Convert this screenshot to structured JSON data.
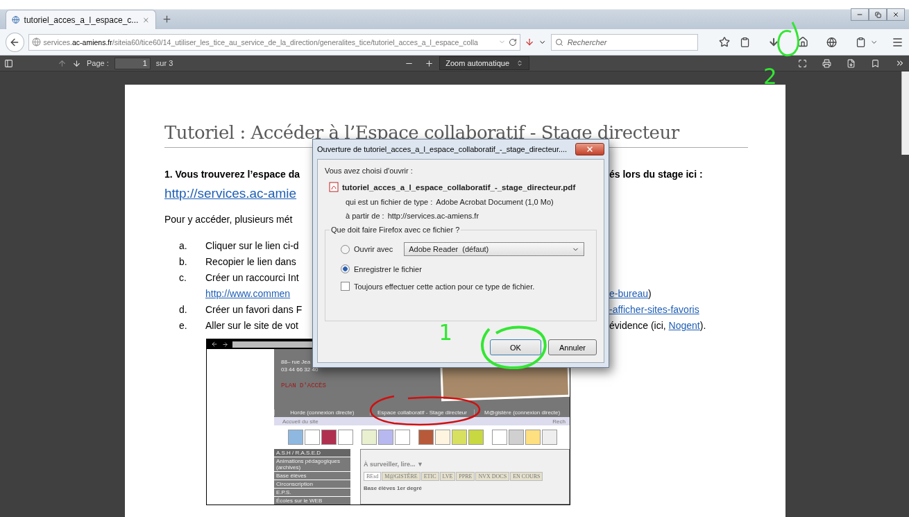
{
  "browser": {
    "tab": {
      "title": "tutoriel_acces_a_l_espace_c...",
      "selected": true
    },
    "address": {
      "prefix": "services.",
      "domain": "ac-amiens.fr",
      "path": "/siteia60/tice60/14_utiliser_les_tice_au_service_de_la_direction/generalites_tice/tutoriel_acces_a_l_espace_colla"
    },
    "search": {
      "placeholder": "Rechercher"
    }
  },
  "pdf_toolbar": {
    "page_label": "Page :",
    "page_value": "1",
    "page_total": "sur 3",
    "zoom": "Zoom automatique"
  },
  "document": {
    "title": "Tutoriel : Accéder à l’Espace collaboratif - Stage directeur",
    "lines": [
      {
        "kind": "bold",
        "left": "1. Vous trouverez l’espace da",
        "right": "és lors du stage ici :"
      },
      {
        "kind": "biglink",
        "left": "http://services.ac-amie"
      },
      {
        "kind": "plain",
        "left": "Pour y accéder, plusieurs mét"
      },
      {
        "kind": "item",
        "marker": "a.",
        "left": "Cliquer sur le lien ci-d"
      },
      {
        "kind": "item",
        "marker": "b.",
        "left": "Recopier le lien dans"
      },
      {
        "kind": "item",
        "marker": "c.",
        "left": "Créer un raccourci Int"
      },
      {
        "kind": "itemlink",
        "left": "http://www.commen",
        "right_link": "e-bureau",
        "right_after": ")"
      },
      {
        "kind": "item",
        "marker": "d.",
        "left": "Créer un favori dans F",
        "right_link": "-afficher-sites-favoris"
      },
      {
        "kind": "item",
        "marker": "e.",
        "left": "Aller sur le site de vot",
        "right_before": "évidence (ici, ",
        "right_link": "Nogent",
        "right_after": ")."
      }
    ],
    "screenshot": {
      "address_lines": [
        "88– rue Jea",
        "03 44 66 32 40"
      ],
      "map_link": "PLAN D'ACCÈS",
      "nav": [
        "Horde (connexion directe)",
        "Espace collaboratif - Stage directeur",
        "M@gistère (connexion directe)"
      ],
      "breadcrumb": "Accueil du site",
      "search_cut": "Rech",
      "menu": [
        "A.S.H / R.A.S.E.D",
        "Animations pédagogiques (archives)",
        "Base élèves",
        "Circonscription",
        "E.P.S.",
        "Écoles sur le WEB"
      ],
      "panel_title": "À surveiller, lire... ▼",
      "tabs": [
        {
          "label": "BEsd",
          "selected": true
        },
        {
          "label": "M@GISTÈRE",
          "selected": false
        },
        {
          "label": "ETIC",
          "selected": false
        },
        {
          "label": "LVE",
          "selected": false
        },
        {
          "label": "PPRE",
          "selected": false
        },
        {
          "label": "NVX DOCS",
          "selected": false
        },
        {
          "label": "EN COURS",
          "selected": false
        }
      ],
      "panel_heading": "Base élèves 1er degré"
    }
  },
  "dialog": {
    "title": "Ouverture de tutoriel_acces_a_l_espace_collaboratif_-_stage_directeur....",
    "intro": "Vous avez choisi d'ouvrir :",
    "filename": "tutoriel_acces_a_l_espace_collaboratif_-_stage_directeur.pdf",
    "details": [
      {
        "label": "qui est un fichier de type :",
        "value": "Adobe Acrobat Document (1,0 Mo)"
      },
      {
        "label": "à partir de :",
        "value": "http://services.ac-amiens.fr"
      }
    ],
    "group_label": "Que doit faire Firefox avec ce fichier ?",
    "options": [
      {
        "label": "Ouvrir avec",
        "selected": false,
        "app": "Adobe Reader  (défaut)"
      },
      {
        "label": "Enregistrer le fichier",
        "selected": true
      }
    ],
    "always": {
      "label": "Toujours effectuer cette action pour ce type de fichier.",
      "checked": false
    },
    "buttons": [
      "OK",
      "Annuler"
    ]
  },
  "annotations": [
    "1",
    "2"
  ]
}
